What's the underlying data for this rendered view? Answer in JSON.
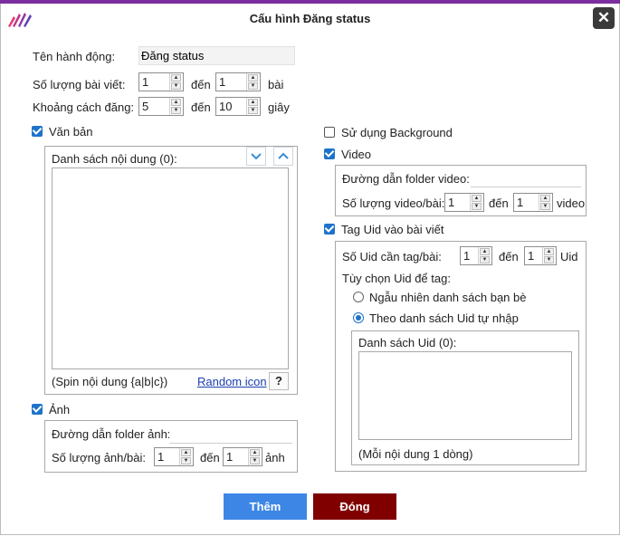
{
  "window": {
    "title": "Cấu hình Đăng status",
    "close_label": "✕"
  },
  "action": {
    "name_label": "Tên hành động:",
    "name_value": "Đăng status"
  },
  "posts": {
    "label": "Số lượng bài viết:",
    "from": "1",
    "to_label": "đến",
    "to": "1",
    "unit": "bài"
  },
  "interval": {
    "label": "Khoảng cách đăng:",
    "from": "5",
    "to_label": "đến",
    "to": "10",
    "unit": "giây"
  },
  "text": {
    "checkbox_label": "Văn bản",
    "checked": true,
    "list_header": "Danh sách nội dung (0):",
    "spin_hint": "(Spin nội dung {a|b|c})",
    "random_icon_link": "Random icon",
    "help_label": "?"
  },
  "image": {
    "checkbox_label": "Ảnh",
    "checked": true,
    "folder_label": "Đường dẫn folder ảnh:",
    "folder_value": "",
    "count_label": "Số lượng ảnh/bài:",
    "from": "1",
    "to_label": "đến",
    "to": "1",
    "unit": "ảnh"
  },
  "background": {
    "checkbox_label": "Sử dụng Background",
    "checked": false
  },
  "video": {
    "checkbox_label": "Video",
    "checked": true,
    "folder_label": "Đường dẫn folder video:",
    "folder_value": "",
    "count_label": "Số lượng video/bài:",
    "from": "1",
    "to_label": "đến",
    "to": "1",
    "unit": "video"
  },
  "tag": {
    "checkbox_label": "Tag Uid vào bài viết",
    "checked": true,
    "count_label": "Số Uid cần tag/bài:",
    "from": "1",
    "to_label": "đến",
    "to": "1",
    "unit": "Uid",
    "option_label": "Tùy chọn Uid để tag:",
    "option_random": "Ngẫu nhiên danh sách bạn bè",
    "option_custom": "Theo danh sách Uid tự nhập",
    "selected_option": "custom",
    "list_header": "Danh sách Uid (0):",
    "list_hint": "(Mỗi nội dung 1 dòng)"
  },
  "footer": {
    "add_label": "Thêm",
    "close_label": "Đóng"
  },
  "colors": {
    "accent": "#1e73c9",
    "topbar": "#7b2f9e",
    "add_button": "#3d86e6",
    "close_button": "#800000"
  }
}
